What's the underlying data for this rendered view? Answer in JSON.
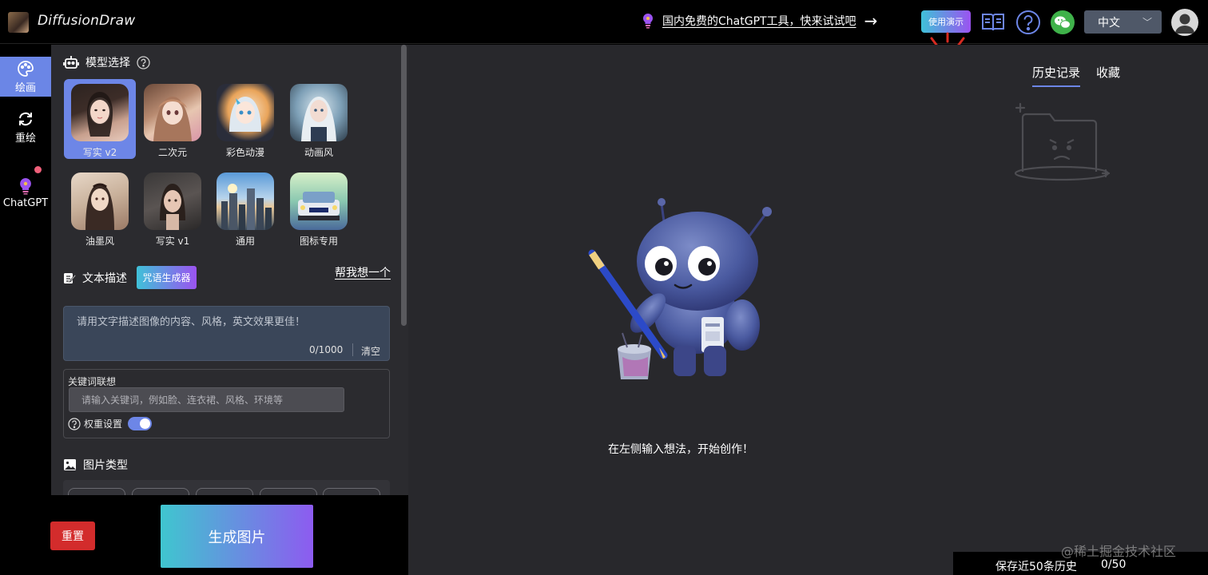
{
  "header": {
    "app_title": "DiffusionDraw",
    "promo_text": "国内免费的ChatGPT工具，快来试试吧",
    "demo_label": "使用演示",
    "language": "中文",
    "icons": [
      "book-icon",
      "help-circle-icon",
      "wechat-icon",
      "user-avatar-icon"
    ]
  },
  "sidebar": {
    "items": [
      {
        "label": "绘画",
        "icon": "palette-icon",
        "active": true
      },
      {
        "label": "重绘",
        "icon": "refresh-icon",
        "active": false
      },
      {
        "label": "ChatGPT",
        "icon": "chatgpt-bulb-icon",
        "active": false
      }
    ]
  },
  "panel": {
    "model_section_title": "模型选择",
    "models": [
      {
        "label": "写实 v2",
        "selected": true
      },
      {
        "label": "二次元",
        "selected": false
      },
      {
        "label": "彩色动漫",
        "selected": false
      },
      {
        "label": "动画风",
        "selected": false
      },
      {
        "label": "油墨风",
        "selected": false
      },
      {
        "label": "写实 v1",
        "selected": false
      },
      {
        "label": "通用",
        "selected": false
      },
      {
        "label": "图标专用",
        "selected": false
      }
    ],
    "text_section_title": "文本描述",
    "spell_generator": "咒语生成器",
    "help_think": "帮我想一个",
    "prompt_placeholder": "请用文字描述图像的内容、风格，英文效果更佳！",
    "prompt_count": "0/1000",
    "clear_label": "清空",
    "keyword_label": "关键词联想",
    "keyword_placeholder": "请输入关键词，例如脸、连衣裙、风格、环境等",
    "weight_label": "权重设置",
    "weight_enabled": true,
    "image_type_title": "图片类型"
  },
  "actions": {
    "reset_label": "重置",
    "generate_label": "生成图片"
  },
  "main": {
    "hint": "在左侧输入想法，开始创作！"
  },
  "history": {
    "tabs": [
      "历史记录",
      "收藏"
    ],
    "active_tab": 0,
    "footer_note": "保存近50条历史",
    "footer_count": "0/50"
  },
  "watermark": "@稀土掘金技术社区",
  "colors": {
    "accent": "#6d86e7",
    "gradient_start": "#3fc1d8",
    "gradient_end": "#9b53f0",
    "danger": "#d32c2c"
  }
}
